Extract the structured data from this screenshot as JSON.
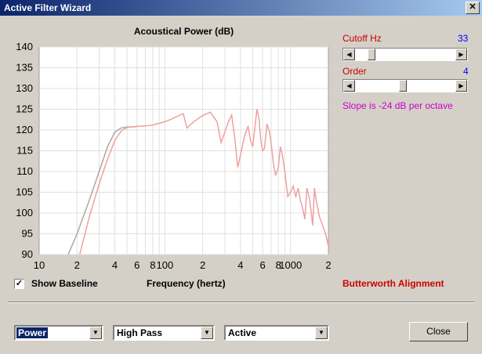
{
  "window": {
    "title": "Active Filter Wizard",
    "close_glyph": "✕"
  },
  "controls": {
    "cutoff_label": "Cutoff  Hz",
    "cutoff_value": "33",
    "cutoff_fraction": 0.13,
    "order_label": "Order",
    "order_value": "4",
    "order_fraction": 0.47,
    "slope_text": "Slope is -24 dB per octave",
    "show_baseline_label": "Show Baseline",
    "show_baseline_checked": true,
    "check_glyph": "✓",
    "alignment_text": "Butterworth Alignment",
    "arrow_left": "◀",
    "arrow_right": "▶",
    "arrow_down": "▼"
  },
  "bottom": {
    "dropdown1": "Power",
    "dropdown2": "High Pass",
    "dropdown3": "Active",
    "close_label": "Close"
  },
  "chart_data": {
    "type": "line",
    "title": "Acoustical Power (dB)",
    "xlabel": "Frequency (hertz)",
    "ylabel": "",
    "xscale": "log",
    "xlim": [
      10,
      2000
    ],
    "ylim": [
      90,
      140
    ],
    "yticks": [
      90,
      95,
      100,
      105,
      110,
      115,
      120,
      125,
      130,
      135,
      140
    ],
    "xticks": [
      {
        "v": 10,
        "l": "10"
      },
      {
        "v": 20,
        "l": "2"
      },
      {
        "v": 40,
        "l": "4"
      },
      {
        "v": 60,
        "l": "6"
      },
      {
        "v": 80,
        "l": "8"
      },
      {
        "v": 100,
        "l": "100"
      },
      {
        "v": 200,
        "l": "2"
      },
      {
        "v": 400,
        "l": "4"
      },
      {
        "v": 600,
        "l": "6"
      },
      {
        "v": 800,
        "l": "8"
      },
      {
        "v": 1000,
        "l": "1000"
      },
      {
        "v": 2000,
        "l": "2"
      }
    ],
    "grid": true,
    "series": [
      {
        "color": "#a8a8a8",
        "x": [
          17,
          20,
          25,
          30,
          35,
          40,
          45,
          50,
          60
        ],
        "y": [
          90,
          95,
          103,
          110,
          116,
          119.5,
          120.5,
          120.7,
          120.8
        ]
      },
      {
        "color": "#f0a0a0",
        "x": [
          21,
          25,
          30,
          35,
          40,
          45,
          50,
          60,
          70,
          80,
          90,
          100,
          110,
          120,
          130,
          140,
          150,
          170,
          200,
          230,
          260,
          280,
          300,
          320,
          340,
          360,
          380,
          400,
          430,
          460,
          480,
          500,
          520,
          540,
          560,
          580,
          600,
          620,
          650,
          680,
          700,
          730,
          760,
          800,
          830,
          860,
          900,
          950,
          1000,
          1050,
          1100,
          1150,
          1200,
          1250,
          1300,
          1350,
          1400,
          1450,
          1500,
          1550,
          1600,
          1700,
          1800,
          1900,
          2000
        ],
        "y": [
          90,
          99,
          107,
          113,
          117.5,
          119.8,
          120.6,
          120.9,
          121,
          121.2,
          121.6,
          122,
          122.5,
          123,
          123.5,
          123.9,
          120.5,
          122,
          123.5,
          124.3,
          122,
          117,
          119.5,
          122,
          123.6,
          118,
          111,
          114,
          118.5,
          121,
          117.5,
          116,
          120.5,
          125,
          123,
          117.5,
          115,
          115.5,
          121.5,
          119.5,
          117,
          112,
          109,
          111,
          116,
          114,
          110,
          104,
          105,
          106.5,
          104,
          106,
          103,
          101,
          98.5,
          106,
          104,
          101,
          97,
          106,
          103,
          99,
          97,
          95,
          92
        ]
      }
    ]
  }
}
